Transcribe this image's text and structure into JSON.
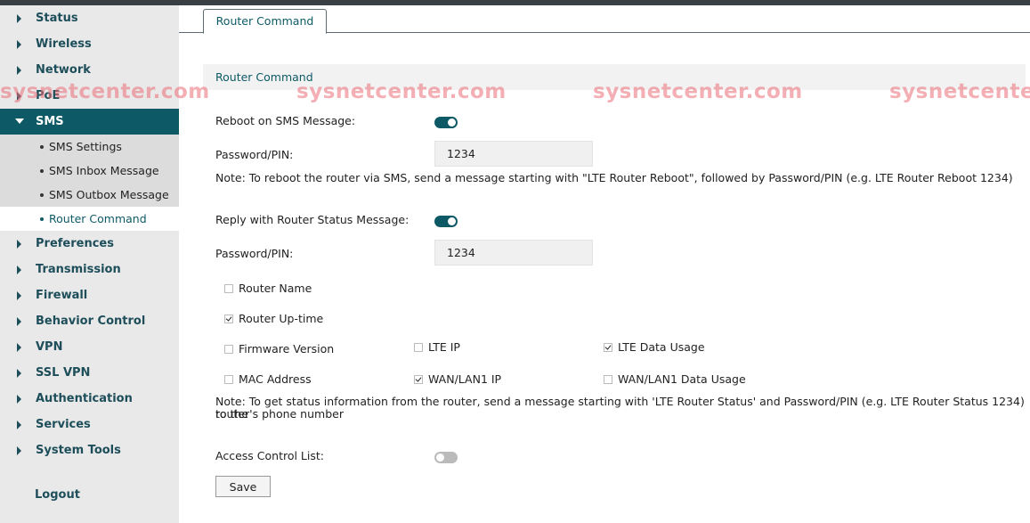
{
  "sidebar": {
    "items_top": [
      {
        "label": "Status"
      },
      {
        "label": "Wireless"
      },
      {
        "label": "Network"
      },
      {
        "label": "PoE"
      },
      {
        "label": "SMS"
      }
    ],
    "sms_sub": [
      {
        "label": "SMS Settings"
      },
      {
        "label": "SMS Inbox Message"
      },
      {
        "label": "SMS Outbox Message"
      },
      {
        "label": "Router Command"
      }
    ],
    "items_bottom": [
      {
        "label": "Preferences"
      },
      {
        "label": "Transmission"
      },
      {
        "label": "Firewall"
      },
      {
        "label": "Behavior Control"
      },
      {
        "label": "VPN"
      },
      {
        "label": "SSL VPN"
      },
      {
        "label": "Authentication"
      },
      {
        "label": "Services"
      },
      {
        "label": "System Tools"
      }
    ],
    "logout": "Logout"
  },
  "tab": {
    "label": "Router Command"
  },
  "section": {
    "title": "Router Command"
  },
  "watermark": {
    "text": "sysnetcenter.com",
    "text_partial": "sysnetcente"
  },
  "reboot": {
    "label": "Reboot on SMS Message:",
    "enabled": true,
    "pin_label": "Password/PIN:",
    "pin_value": "1234",
    "note": "Note: To reboot the router via SMS, send a message starting with \"LTE Router Reboot\", followed by Password/PIN (e.g. LTE Router Reboot 1234)"
  },
  "status": {
    "label": "Reply with Router Status Message:",
    "enabled": true,
    "pin_label": "Password/PIN:",
    "pin_value": "1234",
    "options": {
      "router_name": {
        "label": "Router Name",
        "checked": false
      },
      "router_uptime": {
        "label": "Router Up-time",
        "checked": true
      },
      "firmware_version": {
        "label": "Firmware Version",
        "checked": false
      },
      "lte_ip": {
        "label": "LTE IP",
        "checked": false
      },
      "lte_data_usage": {
        "label": "LTE Data Usage",
        "checked": true
      },
      "mac_address": {
        "label": "MAC Address",
        "checked": false
      },
      "wan_lan1_ip": {
        "label": "WAN/LAN1 IP",
        "checked": true
      },
      "wan_lan1_data_usage": {
        "label": "WAN/LAN1 Data Usage",
        "checked": false
      }
    },
    "note_line1": "Note: To get status information from the router, send a message starting with 'LTE Router Status' and Password/PIN (e.g. LTE Router Status 1234) to the",
    "note_line2": "router's phone number"
  },
  "acl": {
    "label": "Access Control List:",
    "enabled": false
  },
  "save_label": "Save",
  "colors": {
    "accent": "#0d5a66",
    "sidebar_bg": "#e9e9e9",
    "watermark": "#eb6e78"
  }
}
